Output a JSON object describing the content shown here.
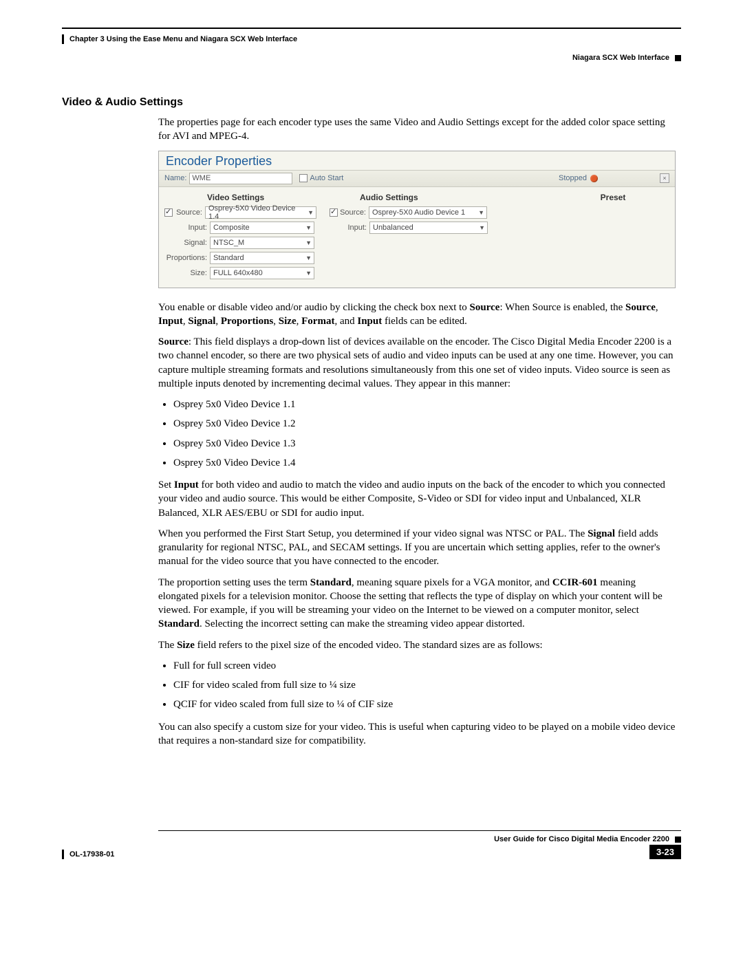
{
  "header": {
    "chapter": "Chapter 3    Using the Ease Menu and Niagara SCX Web Interface",
    "section": "Niagara SCX Web Interface"
  },
  "heading": "Video & Audio Settings",
  "intro": "The properties page for each encoder type uses the same Video and Audio Settings except for the added color space setting for AVI and MPEG-4.",
  "encoder": {
    "title": "Encoder Properties",
    "name_lbl": "Name:",
    "name_val": "WME",
    "autostart": "Auto Start",
    "stopped": "Stopped",
    "video_hdr": "Video Settings",
    "audio_hdr": "Audio Settings",
    "preset_hdr": "Preset",
    "v_source_lbl": "Source:",
    "v_source_val": "Osprey-5X0 Video Device 1.4",
    "v_input_lbl": "Input:",
    "v_input_val": "Composite",
    "signal_lbl": "Signal:",
    "signal_val": "NTSC_M",
    "prop_lbl": "Proportions:",
    "prop_val": "Standard",
    "size_lbl": "Size:",
    "size_val": "FULL 640x480",
    "a_source_lbl": "Source:",
    "a_source_val": "Osprey-5X0 Audio Device 1",
    "a_input_lbl": "Input:",
    "a_input_val": "Unbalanced"
  },
  "p_enable_a": "You enable or disable video and/or audio by clicking the check box next to ",
  "p_enable_b": "Source",
  "p_enable_c": ": When Source is enabled, the ",
  "p_enable_d": "Source",
  "p_enable_e": ", ",
  "p_enable_f": "Input",
  "p_enable_g": ", ",
  "p_enable_h": "Signal",
  "p_enable_i": ", ",
  "p_enable_j": "Proportions",
  "p_enable_k": ", ",
  "p_enable_l": "Size",
  "p_enable_m": ", ",
  "p_enable_n": "Format",
  "p_enable_o": ", and ",
  "p_enable_p": "Input",
  "p_enable_q": " fields can be edited.",
  "p_source_a": "Source",
  "p_source_b": ": This field displays a drop-down list of devices available on the encoder. The Cisco Digital Media Encoder 2200 is a two channel encoder, so there are two physical sets of audio and video inputs can be used at any one time. However, you can capture multiple streaming formats and resolutions simultaneously from this one set of video inputs. Video source is seen as multiple inputs denoted by incrementing decimal values. They appear in this manner:",
  "devices": [
    "Osprey 5x0 Video Device 1.1",
    "Osprey 5x0 Video Device 1.2",
    "Osprey 5x0 Video Device 1.3",
    "Osprey 5x0 Video Device 1.4"
  ],
  "p_setinput_a": "Set ",
  "p_setinput_b": "Input",
  "p_setinput_c": " for both video and audio to match the video and audio inputs on the back of the encoder to which you connected your video and audio source. This would be either Composite, S-Video or SDI for video input and Unbalanced, XLR Balanced, XLR AES/EBU or SDI for audio input.",
  "p_signal_a": "When you performed the First Start Setup, you determined if your video signal was NTSC or PAL. The ",
  "p_signal_b": "Signal",
  "p_signal_c": " field adds granularity for regional NTSC, PAL, and SECAM settings. If you are uncertain which setting applies, refer to the owner's manual for the video source that you have connected to the encoder.",
  "p_prop_a": "The proportion setting uses the term ",
  "p_prop_b": "Standard",
  "p_prop_c": ", meaning square pixels for a VGA monitor, and ",
  "p_prop_d": "CCIR-601",
  "p_prop_e": " meaning elongated pixels for a television monitor. Choose the setting that reflects the type of display on which your content will be viewed. For example, if you will be streaming your video on the Internet to be viewed on a computer monitor, select ",
  "p_prop_f": "Standard",
  "p_prop_g": ". Selecting the incorrect setting can make the streaming video appear distorted.",
  "p_size_a": "The ",
  "p_size_b": "Size",
  "p_size_c": " field refers to the pixel size of the encoded video. The standard sizes are as follows:",
  "sizes": [
    "Full for full screen video",
    "CIF for video scaled from full size to ¼ size",
    "QCIF for video scaled from full size to ¼ of CIF size"
  ],
  "p_custom": "You can also specify a custom size for your video. This is useful when capturing video to be played on a mobile video device that requires a non-standard size for compatibility.",
  "footer": {
    "guide": "User Guide for Cisco Digital Media Encoder 2200",
    "docnum": "OL-17938-01",
    "page": "3-23"
  }
}
